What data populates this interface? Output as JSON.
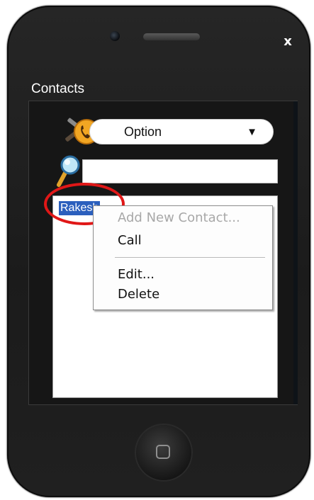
{
  "window": {
    "close_label": "x",
    "title": "Contacts"
  },
  "option_bar": {
    "icon": "phone-tools-icon",
    "selected": "Option",
    "arrow": "▼"
  },
  "search": {
    "icon": "magnifier-icon",
    "value": "",
    "placeholder": ""
  },
  "contacts": {
    "items": [
      {
        "label": "Rakesh",
        "selected": true
      }
    ]
  },
  "context_menu": {
    "items": [
      {
        "label": "Add New Contact...",
        "enabled": false
      },
      {
        "label": "Call",
        "enabled": true
      },
      {
        "label": "Edit...",
        "enabled": true
      },
      {
        "label": "Delete",
        "enabled": true
      }
    ]
  },
  "annotation": {
    "color": "#e01717"
  },
  "device": {
    "home_icon": "home-square-icon"
  }
}
